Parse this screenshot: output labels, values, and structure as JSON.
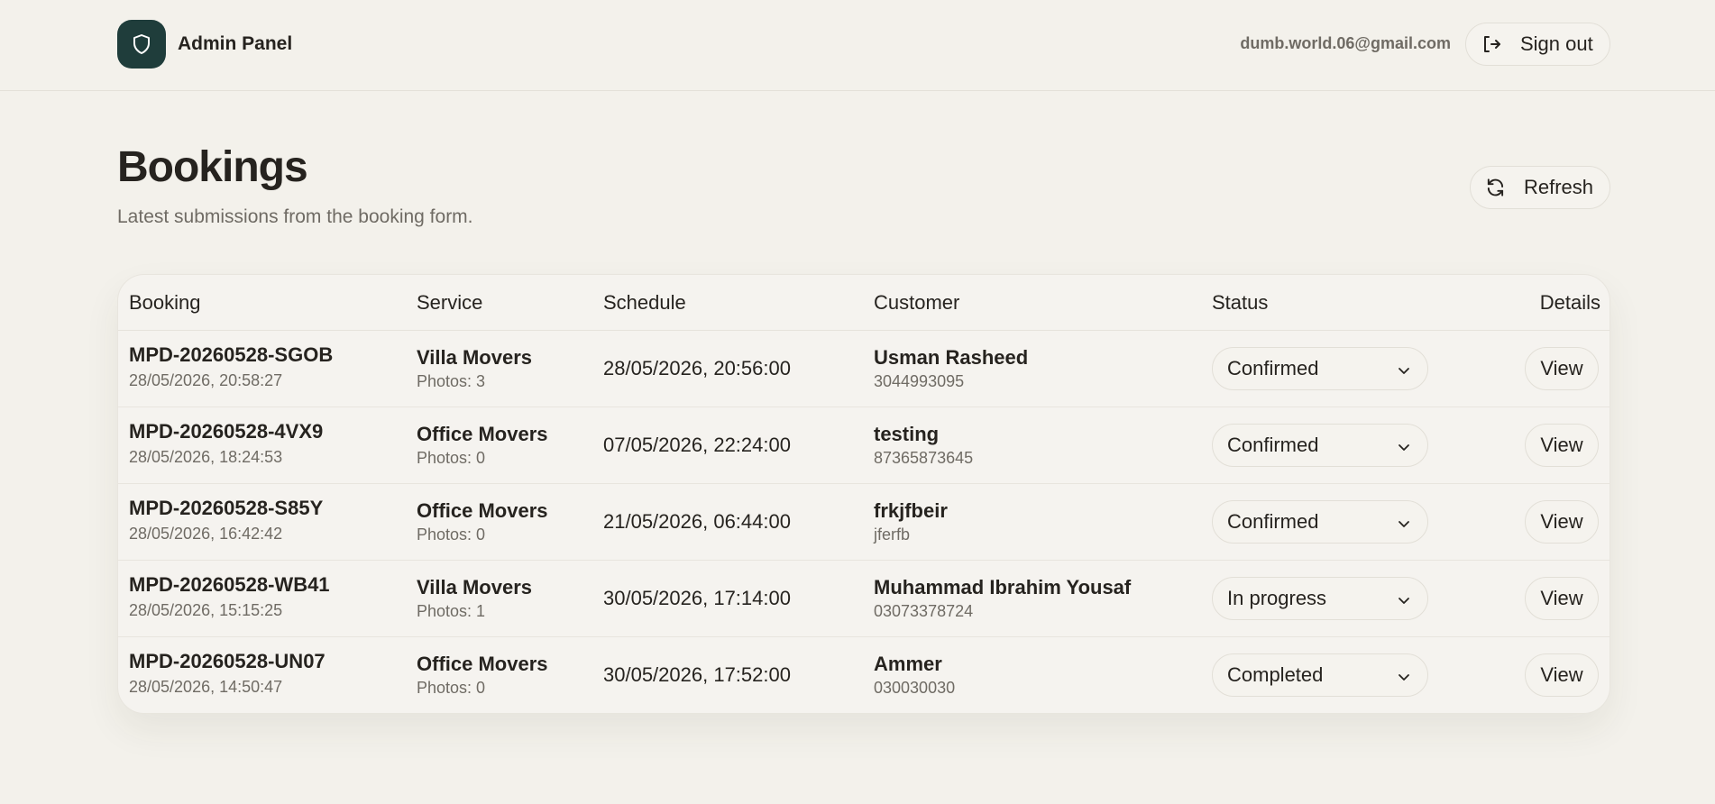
{
  "header": {
    "brand": "Admin Panel",
    "brand_icon": "shield-icon",
    "user_email": "dumb.world.06@gmail.com",
    "signout_label": "Sign out",
    "signout_icon": "sign-out-icon"
  },
  "page": {
    "title": "Bookings",
    "subtitle": "Latest submissions from the booking form.",
    "refresh_label": "Refresh",
    "refresh_icon": "refresh-icon"
  },
  "table": {
    "columns": [
      "Booking",
      "Service",
      "Schedule",
      "Customer",
      "Status",
      "Details"
    ],
    "rows": [
      {
        "id": "MPD-20260528-SGOB",
        "created": "28/05/2026, 20:58:27",
        "service": "Villa Movers",
        "photos": "Photos: 3",
        "schedule": "28/05/2026, 20:56:00",
        "customer": "Usman Rasheed",
        "phone": "3044993095",
        "status": "Confirmed",
        "action": "View"
      },
      {
        "id": "MPD-20260528-4VX9",
        "created": "28/05/2026, 18:24:53",
        "service": "Office Movers",
        "photos": "Photos: 0",
        "schedule": "07/05/2026, 22:24:00",
        "customer": "testing",
        "phone": "87365873645",
        "status": "Confirmed",
        "action": "View"
      },
      {
        "id": "MPD-20260528-S85Y",
        "created": "28/05/2026, 16:42:42",
        "service": "Office Movers",
        "photos": "Photos: 0",
        "schedule": "21/05/2026, 06:44:00",
        "customer": "frkjfbeir",
        "phone": "jferfb",
        "status": "Confirmed",
        "action": "View"
      },
      {
        "id": "MPD-20260528-WB41",
        "created": "28/05/2026, 15:15:25",
        "service": "Villa Movers",
        "photos": "Photos: 1",
        "schedule": "30/05/2026, 17:14:00",
        "customer": "Muhammad Ibrahim Yousaf",
        "phone": "03073378724",
        "status": "In progress",
        "action": "View"
      },
      {
        "id": "MPD-20260528-UN07",
        "created": "28/05/2026, 14:50:47",
        "service": "Office Movers",
        "photos": "Photos: 0",
        "schedule": "30/05/2026, 17:52:00",
        "customer": "Ammer",
        "phone": "030030030",
        "status": "Completed",
        "action": "View"
      }
    ]
  },
  "colors": {
    "background": "#f3f1eb",
    "brand": "#1f3d3b",
    "text": "#26231f",
    "muted": "#6f6b64"
  }
}
